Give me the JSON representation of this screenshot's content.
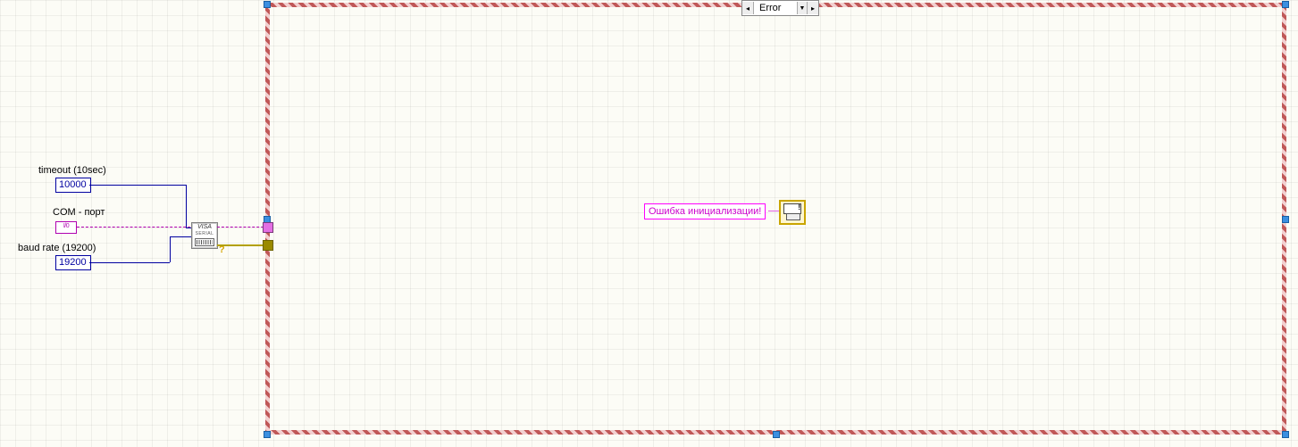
{
  "inputs": {
    "timeout_label": "timeout (10sec)",
    "timeout_value": "10000",
    "com_label": "COM - порт",
    "io_text": "I/0",
    "baud_label": "baud rate (19200)",
    "baud_value": "19200"
  },
  "visa_node": {
    "top": "VISA",
    "mid": "SERIAL"
  },
  "case": {
    "selector_label": "Error",
    "error_string": "Ошибка инициализации!"
  },
  "colors": {
    "wire_int": "#0000a0",
    "wire_resource": "#b000b0",
    "wire_string": "#e060e0",
    "case_border_a": "#c05858",
    "case_border_b": "#f2d0d0"
  }
}
